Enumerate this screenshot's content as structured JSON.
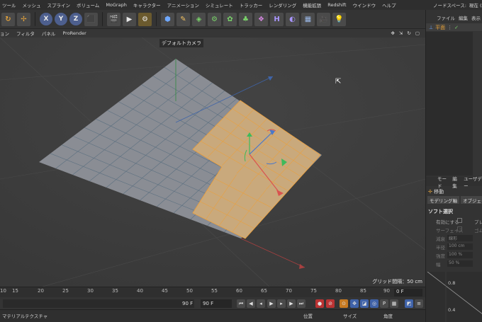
{
  "menubar": {
    "items": [
      "ツール",
      "メッシュ",
      "スプライン",
      "ボリューム",
      "MoGraph",
      "キャラクター",
      "アニメーション",
      "シミュレート",
      "トラッカー",
      "レンダリング",
      "機能拡張",
      "Redshift",
      "ウインドウ",
      "ヘルプ"
    ]
  },
  "right_header": {
    "items": [
      "ノードスペース:",
      "現在 (標準"
    ]
  },
  "toolbar": {
    "axis_x": "X",
    "axis_y": "Y",
    "axis_z": "Z"
  },
  "viewport_menu": {
    "items": [
      "ョン",
      "フィルタ",
      "パネル",
      "ProRender"
    ]
  },
  "viewport_icons": [
    "move-icon",
    "arrows-icon",
    "rotate-icon",
    "square-icon"
  ],
  "viewport": {
    "camera_label": "デフォルトカメラ",
    "grid_spacing": "グリッド間隔：50 cm"
  },
  "colors": {
    "plane_gray": "#8a8d94",
    "plane_selected": "#c9a97c",
    "selected_edge": "#f0a13a",
    "axis_x": "#d9534f",
    "axis_y": "#3eba5a",
    "axis_z": "#4a78c9"
  },
  "timeline": {
    "ticks": [
      "10",
      "15",
      "20",
      "25",
      "30",
      "35",
      "40",
      "45",
      "50",
      "55",
      "60",
      "65",
      "70",
      "75",
      "80",
      "85",
      "90"
    ],
    "current_frame": "0 F"
  },
  "transport": {
    "end_frame_a": "90 F",
    "end_frame_b": "90 F"
  },
  "bottom_panel": {
    "tabs": [
      "マテリアル",
      "テクスチャ"
    ],
    "coord_headers": [
      "位置",
      "サイズ",
      "角度"
    ]
  },
  "object_manager": {
    "menu": [
      "ファイル",
      "編集",
      "表示"
    ],
    "object_name": "平面"
  },
  "attribute_manager": {
    "menu": [
      "モード",
      "編集",
      "ユーザデー"
    ],
    "tool_name": "移動",
    "tabs": [
      "モデリング軸",
      "オブジェクト軸"
    ],
    "section": "ソフト選択",
    "props": [
      {
        "label": "有効にする",
        "extra": "プレ"
      },
      {
        "label": "サーフェイス",
        "extra": "ゴム"
      },
      {
        "label": "減衰",
        "value": "線形"
      },
      {
        "label": "半径",
        "value": "100 cm"
      },
      {
        "label": "強度",
        "value": "100 %"
      },
      {
        "label": "幅",
        "value": "50 %"
      }
    ],
    "graph_ticks": [
      "0.8",
      "0.4"
    ]
  }
}
